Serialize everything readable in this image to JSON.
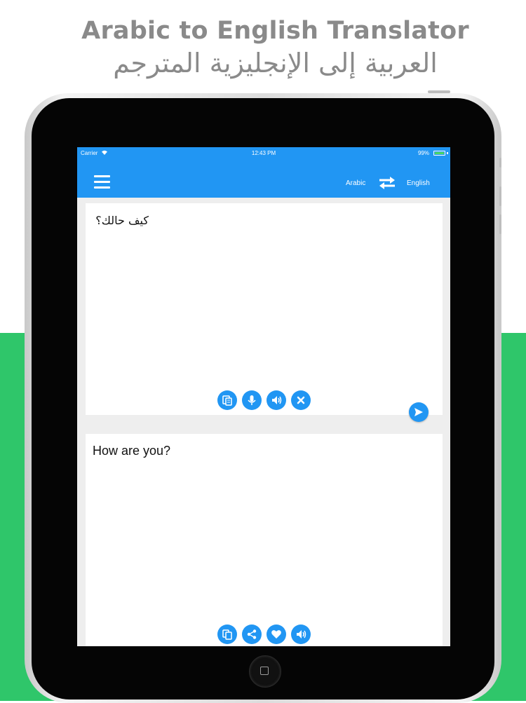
{
  "promo": {
    "title": "Arabic to English Translator",
    "title_arabic": "العربية إلى الإنجليزية المترجم"
  },
  "status_bar": {
    "carrier": "Carrier",
    "time": "12:43 PM",
    "battery": "99%"
  },
  "app_bar": {
    "menu_icon": "hamburger-menu-icon",
    "source_language": "Arabic",
    "swap_icon": "swap-arrows-icon",
    "target_language": "English"
  },
  "input": {
    "text": "كيف حالك؟",
    "actions": [
      "paste-icon",
      "microphone-icon",
      "speaker-icon",
      "clear-icon"
    ],
    "send_icon": "send-icon"
  },
  "output": {
    "text": "How are you?",
    "actions": [
      "copy-icon",
      "share-icon",
      "favorite-icon",
      "speaker-icon"
    ]
  },
  "colors": {
    "accent": "#2196f3",
    "promo_green": "#2fc66a",
    "headline_gray": "#8a8a8a"
  }
}
